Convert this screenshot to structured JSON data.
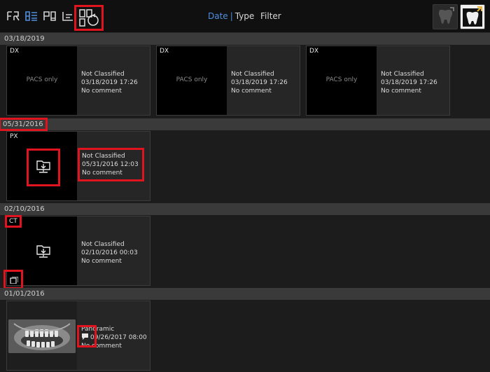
{
  "toolbar": {
    "view_icons": [
      "grid-view-icon",
      "list-view-icon",
      "detail-view-icon",
      "timeline-view-icon",
      "layout-rotate-icon"
    ],
    "sort": {
      "date_label": "Date",
      "type_label": "Type",
      "separator": "|"
    },
    "filter_label": "Filter",
    "buttons": [
      "tooth-view-icon",
      "tooth-export-icon"
    ]
  },
  "groups": [
    {
      "date": "03/18/2019",
      "cards": [
        {
          "modality": "DX",
          "thumb_text": "PACS only",
          "classification": "Not Classified",
          "datetime": "03/18/2019 17:26",
          "comment": "No comment"
        },
        {
          "modality": "DX",
          "thumb_text": "PACS only",
          "classification": "Not Classified",
          "datetime": "03/18/2019 17:26",
          "comment": "No comment"
        },
        {
          "modality": "DX",
          "thumb_text": "PACS only",
          "classification": "Not Classified",
          "datetime": "03/18/2019 17:26",
          "comment": "No comment"
        }
      ]
    },
    {
      "date": "05/31/2016",
      "cards": [
        {
          "modality": "PX",
          "thumb_icon": "download-folder-icon",
          "classification": "Not Classified",
          "datetime": "05/31/2016 12:03",
          "comment": "No comment"
        }
      ]
    },
    {
      "date": "02/10/2016",
      "cards": [
        {
          "modality": "CT",
          "thumb_icon": "download-folder-icon",
          "classification": "Not Classified",
          "datetime": "02/10/2016 00:03",
          "comment": "No comment"
        }
      ]
    },
    {
      "date": "01/01/2016",
      "cards": [
        {
          "modality": "",
          "thumb_icon": "panoramic-xray-thumbnail",
          "classification": "Panoramic",
          "datetime": "09/26/2017 08:00",
          "comment": "No comment"
        }
      ]
    }
  ]
}
